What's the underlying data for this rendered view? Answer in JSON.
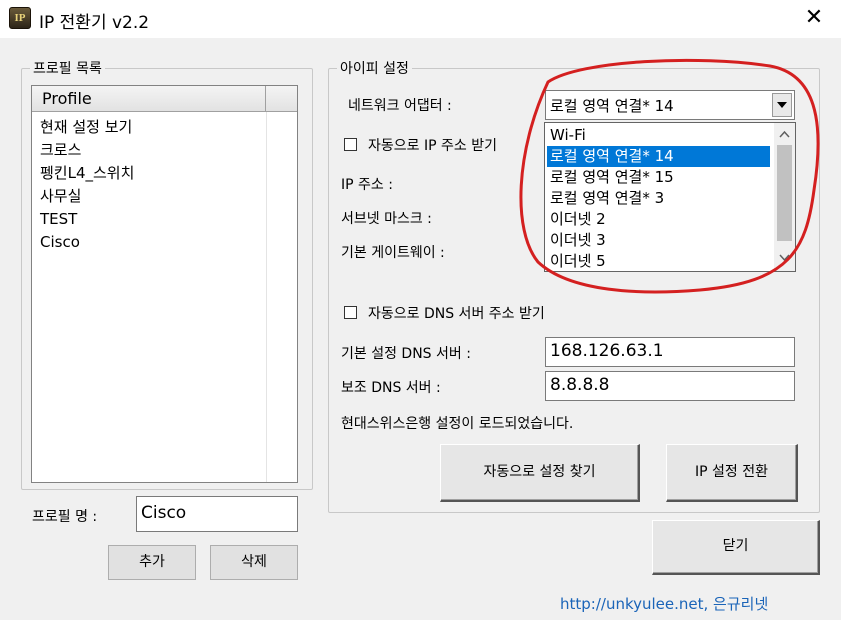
{
  "window": {
    "title": "IP 전환기 v2.2",
    "app_icon": "IP",
    "close_symbol": "✕"
  },
  "profile_list": {
    "group_title": "프로필 목록",
    "column_header": "Profile",
    "items": [
      "현재 설정 보기",
      "크로스",
      "펭킨L4_스위치",
      "사무실",
      "TEST",
      "Cisco"
    ]
  },
  "profile_name": {
    "label": "프로필 명 :",
    "value": "Cisco"
  },
  "buttons": {
    "add": "추가",
    "delete": "삭제",
    "auto_find": "자동으로 설정 찾기",
    "switch_ip": "IP 설정 전환",
    "close": "닫기"
  },
  "ip_settings": {
    "group_title": "아이피 설정",
    "adapter_label": "네트워크 어댑터 :",
    "adapter_selected": "로컬 영역 연결* 14",
    "adapter_options": [
      "Wi-Fi",
      "로컬 영역 연결* 14",
      "로컬 영역 연결* 15",
      "로컬 영역 연결* 3",
      "이더넷 2",
      "이더넷 3",
      "이더넷 5"
    ],
    "auto_ip_label": "자동으로 IP 주소 받기",
    "auto_ip_checked": false,
    "ip_label": "IP 주소 :",
    "subnet_label": "서브넷 마스크 :",
    "gateway_label": "기본 게이트웨이 :",
    "auto_dns_label": "자동으로 DNS 서버 주소 받기",
    "auto_dns_checked": false,
    "dns_primary_label": "기본 설정 DNS 서버 :",
    "dns_primary_value": "168.126.63.1",
    "dns_secondary_label": "보조 DNS 서버 :",
    "dns_secondary_value": "8.8.8.8",
    "status_message": "현대스위스은행 설정이 로드되었습니다."
  },
  "footer": {
    "link_text": "http://unkyulee.net, 은규리넷"
  },
  "colors": {
    "selection": "#0078d7",
    "annotation": "#d42020",
    "link": "#1a64b8"
  }
}
